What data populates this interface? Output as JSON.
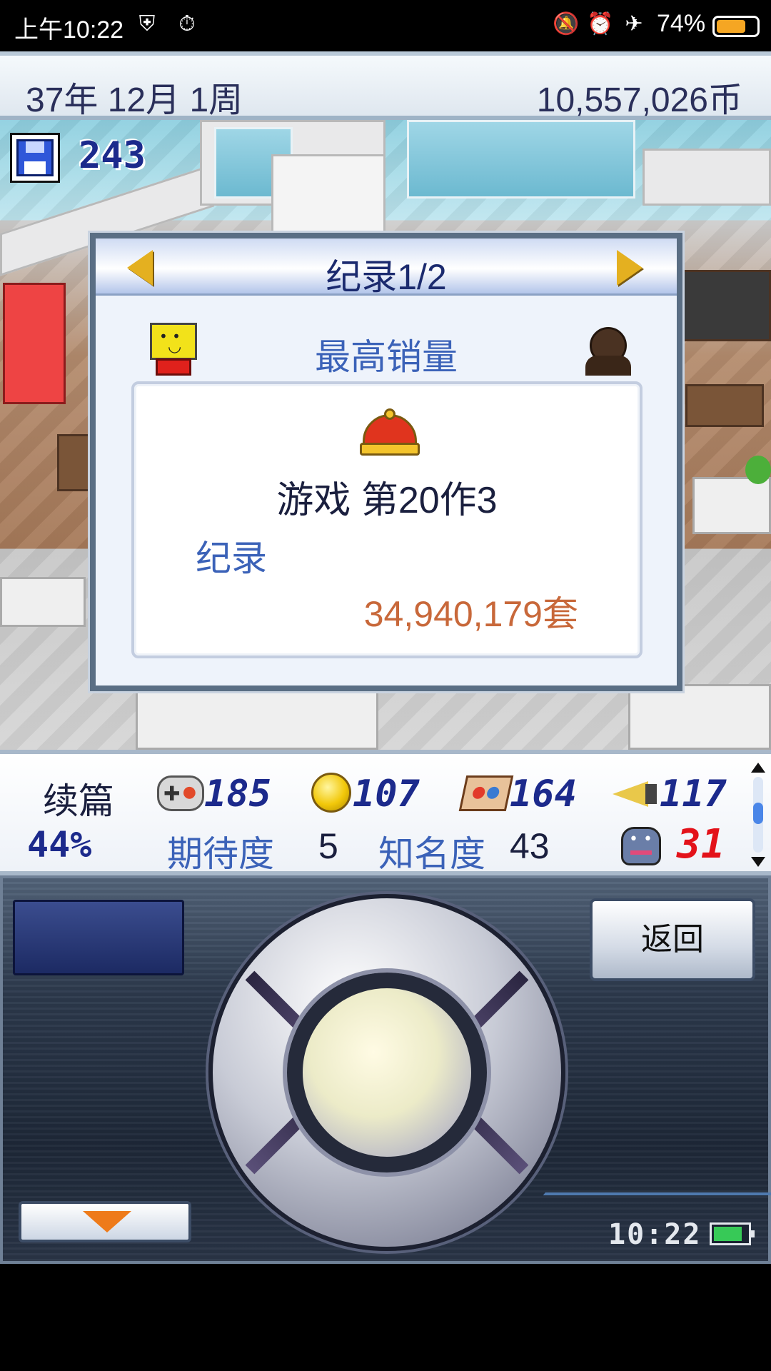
{
  "status_bar": {
    "time": "上午10:22",
    "battery_percent": "74%",
    "battery_level": 0.74,
    "icons": [
      "shield-lightning-icon",
      "stopwatch-icon",
      "mute-icon",
      "alarm-icon",
      "airplane-icon",
      "battery-icon"
    ]
  },
  "top_bar": {
    "date": "37年 12月 1周",
    "money": "10,557,026币"
  },
  "scene": {
    "points": "243"
  },
  "dialog": {
    "title": "纪录1/2",
    "subtitle": "最高销量",
    "game_name": "游戏 第20作3",
    "record_label": "纪录",
    "record_value": "34,940,179套"
  },
  "stats": {
    "genre": "续篇",
    "progress": "44%",
    "fun": "185",
    "creativity": "107",
    "graphics": "164",
    "sound": "117",
    "expectation_label": "期待度",
    "expectation_value": "5",
    "fame_label": "知名度",
    "fame_value": "43",
    "bugs": "31"
  },
  "controller": {
    "back_label": "返回",
    "clock": "10:22",
    "battery_level": 0.85
  },
  "colors": {
    "accent_blue": "#3b62b8",
    "record_orange": "#c8683a",
    "bug_red": "#e3121a"
  }
}
